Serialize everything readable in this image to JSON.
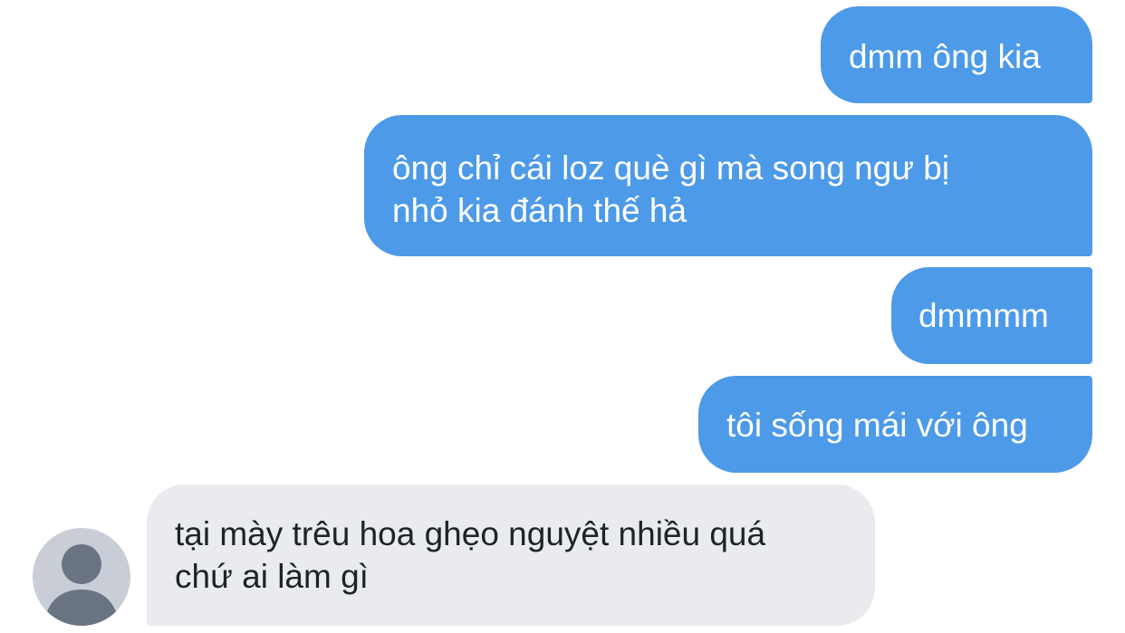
{
  "messages": [
    {
      "direction": "sent",
      "text": "dmm ông kia"
    },
    {
      "direction": "sent",
      "text": "ông chỉ cái loz què gì mà song ngư bị\nnhỏ kia đánh thế hả"
    },
    {
      "direction": "sent",
      "text": "dmmmm"
    },
    {
      "direction": "sent",
      "text": "tôi sống mái với ông"
    },
    {
      "direction": "received",
      "text": "tại mày trêu hoa ghẹo nguyệt nhiều quá\nchứ ai làm gì"
    }
  ],
  "avatar": {
    "icon": "default-user-icon"
  },
  "colors": {
    "sent_bubble": "#4d9ae8",
    "received_bubble": "#e9ebee",
    "sent_text": "#ffffff",
    "received_text": "#1f2328",
    "avatar_bg": "#c9ced6",
    "avatar_figure": "#6b7483"
  }
}
